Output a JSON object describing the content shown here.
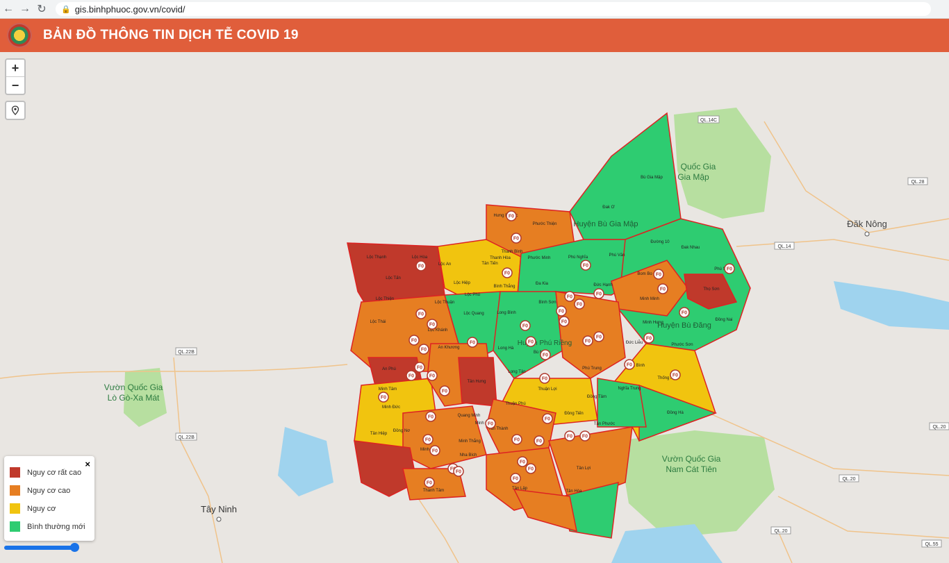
{
  "browser": {
    "url": "gis.binhphuoc.gov.vn/covid/"
  },
  "header": {
    "title": "BẢN ĐỒ THÔNG TIN DỊCH TỄ COVID 19"
  },
  "controls": {
    "zoom_in": "+",
    "zoom_out": "−"
  },
  "legend": {
    "close": "×",
    "items": [
      {
        "label": "Nguy cơ rất cao",
        "color": "#c0392b"
      },
      {
        "label": "Nguy cơ cao",
        "color": "#e67e22"
      },
      {
        "label": "Nguy cơ",
        "color": "#f1c40f"
      },
      {
        "label": "Bình thường mới",
        "color": "#2ecc71"
      }
    ]
  },
  "map": {
    "places": {
      "dak_nong": "Đăk Nông",
      "tay_ninh": "Tây Ninh",
      "vqg_gia_map_1": "Quốc Gia",
      "vqg_gia_map_2": "Gia Mập",
      "vqg_lo_go_1": "Vườn Quốc Gia",
      "vqg_lo_go_2": "Lò Gò-Xa Mát",
      "vqg_cat_tien_1": "Vườn Quốc Gia",
      "vqg_cat_tien_2": "Nam Cát Tiên",
      "huyen_bu_gia_map": "Huyện Bù Gia Mập",
      "huyen_bu_dang": "Huyện Bù Đăng"
    },
    "roads": {
      "ql14c": "QL.14C",
      "ql28": "QL.28",
      "ql14": "QL.14",
      "ql22b_1": "QL.22B",
      "ql22b_2": "QL.22B",
      "ql20_1": "QL.20",
      "ql20_2": "QL.20",
      "ql20_3": "QL.20",
      "ql55": "QL.55"
    },
    "communes": {
      "bu_gia_map": "Bù Gia Mập",
      "dak_o": "Đak Ơ",
      "phuoc_thien": "Phước Thiện",
      "hung_phuoc": "Hưng Phước",
      "loc_thanh": "Lộc Thạnh",
      "loc_hoa": "Lộc Hòa",
      "loc_tan": "Lộc Tấn",
      "loc_an": "Lộc An",
      "loc_hiep": "Lộc Hiệp",
      "loc_thien": "Lộc Thiện",
      "loc_thuan": "Lộc Thuận",
      "loc_phu": "Lộc Phú",
      "loc_quang": "Lộc Quang",
      "loc_khanh": "Lộc Khánh",
      "loc_thai": "Lộc Thái",
      "an_khuong": "An Khương",
      "tan_hung": "Tân Hưng",
      "an_phu": "An Phú",
      "minh_tam": "Minh Tâm",
      "minh_duc": "Minh Đức",
      "dong_no": "Đồng Nơ",
      "tan_hiep": "Tân Hiệp",
      "thanh_binh": "Thanh Bình",
      "thanh_hoa": "Thanh Hòa",
      "tan_tien": "Tân Tiến",
      "phuoc_minh": "Phước Minh",
      "binh_thang": "Bình Thắng",
      "da_kia": "Đa Kia",
      "phu_nghia": "Phú Nghĩa",
      "phu_van": "Phú Văn",
      "duc_hanh": "Đức Hạnh",
      "long_binh": "Long Bình",
      "binh_son": "Bình Sơn",
      "long_ha": "Long Hà",
      "long_tan": "Long Tân",
      "phu_rieng": "Huyện Phú Riềng",
      "bu_nho": "Bù Nho",
      "phu_trung": "Phú Trung",
      "thuan_loi": "Thuận Lợi",
      "dong_tam": "Đồng Tâm",
      "thuan_phu": "Thuận Phú",
      "dong_tien": "Đồng Tiến",
      "tan_phuoc": "Tân Phước",
      "tan_thanh": "Tân Thành",
      "tan_loi": "Tân Lợi",
      "tan_hoa": "Tân Hòa",
      "tan_lap": "Tân Lập",
      "duong_10": "Đường 10",
      "dak_nhau": "Đak Nhau",
      "bom_bo": "Bom Bo",
      "tho_son": "Thọ Sơn",
      "dong_nai": "Đồng Nai",
      "minh_hung": "Minh Hưng",
      "phuoc_son": "Phước Sơn",
      "nghia_binh": "Nghĩa Bình",
      "nghia_trung": "Nghĩa Trung",
      "dong_ha": "Đồng Hà",
      "thong_nhat": "Thống Nhất",
      "phu_son": "Phú Sơn",
      "kinh_minh": "Minh Minh",
      "duc_lieu": "Đức Liễu",
      "minh_thang": "Minh Thắng",
      "nha_bich": "Nha Bích",
      "minh_long": "Minh Long",
      "thanh_tam": "Thành Tâm",
      "quang_minh": "Quang Minh",
      "minh_lap": "Minh Lập"
    },
    "marker": "F0"
  }
}
